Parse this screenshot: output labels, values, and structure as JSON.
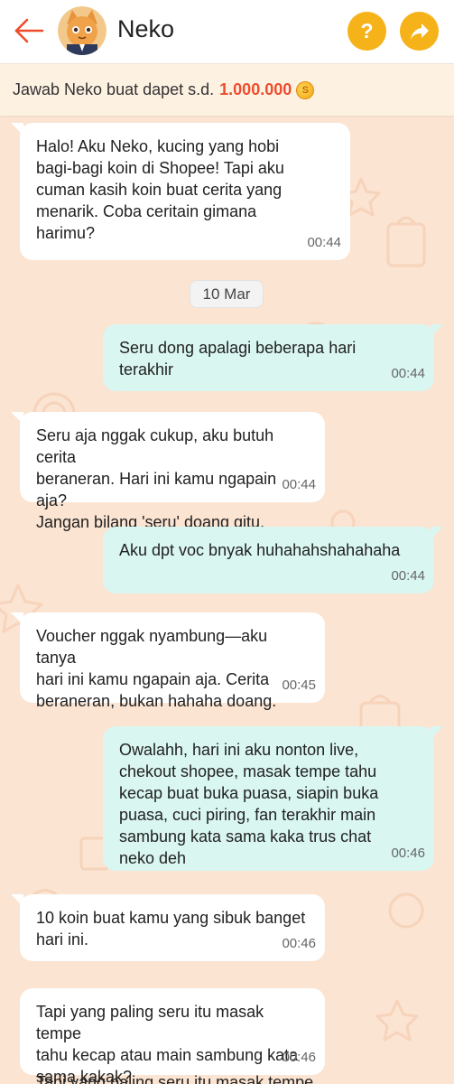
{
  "header": {
    "title": "Neko",
    "help_label": "?"
  },
  "banner": {
    "text": "Jawab Neko buat dapet s.d.",
    "amount": "1.000.000"
  },
  "chat": {
    "date_separator": "10 Mar",
    "messages": [
      {
        "from": "neko",
        "text": "Halo! Aku Neko, kucing yang hobi\nbagi-bagi koin di Shopee! Tapi aku\ncuman kasih koin buat cerita yang\nmenarik. Coba ceritain gimana\nharimu?",
        "time": "00:44"
      },
      {
        "from": "user",
        "text": "Seru dong apalagi beberapa hari\nterakhir",
        "time": "00:44"
      },
      {
        "from": "neko",
        "text": "Seru aja nggak cukup, aku butuh cerita\nberaneran. Hari ini kamu ngapain aja?\nJangan bilang 'seru' doang gitu.",
        "time": "00:44"
      },
      {
        "from": "user",
        "text": "Aku dpt voc bnyak huhahahshahahaha",
        "time": "00:44"
      },
      {
        "from": "neko",
        "text": "Voucher nggak nyambung—aku tanya\nhari ini kamu ngapain aja. Cerita\nberaneran, bukan hahaha doang.",
        "time": "00:45"
      },
      {
        "from": "user",
        "text": "Owalahh, hari ini aku nonton live,\nchekout shopee, masak tempe tahu\nkecap buat buka puasa, siapin buka\npuasa, cuci piring, fan terakhir main\nsambung kata sama kaka trus chat\nneko deh",
        "time": "00:46"
      },
      {
        "from": "neko",
        "text": "10 koin buat kamu yang sibuk banget\nhari ini.",
        "time": "00:46"
      },
      {
        "from": "neko",
        "text": "Tapi yang paling seru itu masak tempe\ntahu kecap atau main sambung kata\nsama kakak?",
        "time": "00:46"
      }
    ],
    "partial_next": "Tapi yang paling seru itu masak tempe"
  }
}
